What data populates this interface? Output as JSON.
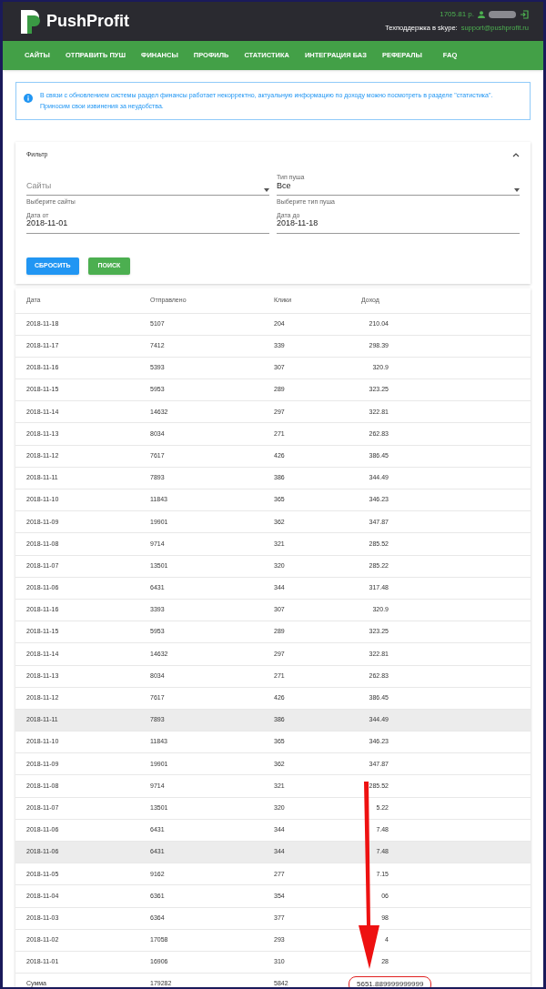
{
  "header": {
    "brand": "PushProfit",
    "balance": "1705.81 р.",
    "support_label": "Техподдержка в skype:",
    "support_contact": "support@pushprofit.ru"
  },
  "nav": [
    "САЙТЫ",
    "ОТПРАВИТЬ ПУШ",
    "ФИНАНСЫ",
    "ПРОФИЛЬ",
    "СТАТИСТИКА",
    "ИНТЕГРАЦИЯ БАЗ",
    "РЕФЕРАЛЫ",
    "FAQ"
  ],
  "alert": "В связи с обновлением системы раздел финансы работает некорректно, актуальную информацию по доходу можно посмотреть в разделе \"статистика\". Приносим свои извинения за неудобства.",
  "filter": {
    "title": "Фильтр",
    "expanded": true,
    "sites": {
      "kind": "select",
      "placeholder": "Сайты",
      "hint": "Выберите сайты"
    },
    "push_type": {
      "kind": "select",
      "label": "Тип пуша",
      "value": "Все",
      "hint": "Выберите тип пуша"
    },
    "date_from": {
      "label": "Дата от",
      "value": "2018-11-01"
    },
    "date_to": {
      "label": "Дата до",
      "value": "2018-11-18"
    },
    "reset_button": "СБРОСИТЬ",
    "search_button": "ПОИСК"
  },
  "table": {
    "columns": [
      "Дата",
      "Отправлено",
      "Клики",
      "Доход"
    ],
    "rows": [
      {
        "cells": [
          "2018-11-18",
          "5107",
          "204",
          "210.04"
        ],
        "highlighted": false
      },
      {
        "cells": [
          "2018-11-17",
          "7412",
          "339",
          "298.39"
        ],
        "highlighted": false
      },
      {
        "cells": [
          "2018-11-16",
          "5393",
          "307",
          "320.9"
        ],
        "highlighted": false
      },
      {
        "cells": [
          "2018-11-15",
          "5953",
          "289",
          "323.25"
        ],
        "highlighted": false
      },
      {
        "cells": [
          "2018-11-14",
          "14632",
          "297",
          "322.81"
        ],
        "highlighted": false
      },
      {
        "cells": [
          "2018-11-13",
          "8034",
          "271",
          "262.83"
        ],
        "highlighted": false
      },
      {
        "cells": [
          "2018-11-12",
          "7617",
          "426",
          "386.45"
        ],
        "highlighted": false
      },
      {
        "cells": [
          "2018-11-11",
          "7893",
          "386",
          "344.49"
        ],
        "highlighted": false
      },
      {
        "cells": [
          "2018-11-10",
          "11843",
          "365",
          "346.23"
        ],
        "highlighted": false
      },
      {
        "cells": [
          "2018-11-09",
          "19901",
          "362",
          "347.87"
        ],
        "highlighted": false
      },
      {
        "cells": [
          "2018-11-08",
          "9714",
          "321",
          "285.52"
        ],
        "highlighted": false
      },
      {
        "cells": [
          "2018-11-07",
          "13501",
          "320",
          "285.22"
        ],
        "highlighted": false
      },
      {
        "cells": [
          "2018-11-06",
          "6431",
          "344",
          "317.48"
        ],
        "highlighted": false
      },
      {
        "cells": [
          "2018-11-16",
          "3393",
          "307",
          "320.9"
        ],
        "highlighted": false
      },
      {
        "cells": [
          "2018-11-15",
          "5953",
          "289",
          "323.25"
        ],
        "highlighted": false
      },
      {
        "cells": [
          "2018-11-14",
          "14632",
          "297",
          "322.81"
        ],
        "highlighted": false
      },
      {
        "cells": [
          "2018-11-13",
          "8034",
          "271",
          "262.83"
        ],
        "highlighted": false
      },
      {
        "cells": [
          "2018-11-12",
          "7617",
          "426",
          "386.45"
        ],
        "highlighted": false
      },
      {
        "cells": [
          "2018-11-11",
          "7893",
          "386",
          "344.49"
        ],
        "highlighted": true
      },
      {
        "cells": [
          "2018-11-10",
          "11843",
          "365",
          "346.23"
        ],
        "highlighted": false
      },
      {
        "cells": [
          "2018-11-09",
          "19901",
          "362",
          "347.87"
        ],
        "highlighted": false
      },
      {
        "cells": [
          "2018-11-08",
          "9714",
          "321",
          "285.52"
        ],
        "highlighted": false
      },
      {
        "cells": [
          "2018-11-07",
          "13501",
          "320",
          "5.22"
        ],
        "highlighted": false
      },
      {
        "cells": [
          "2018-11-06",
          "6431",
          "344",
          "7.48"
        ],
        "highlighted": false
      },
      {
        "cells": [
          "2018-11-06",
          "6431",
          "344",
          "7.48"
        ],
        "highlighted": true
      },
      {
        "cells": [
          "2018-11-05",
          "9162",
          "277",
          "7.15"
        ],
        "highlighted": false
      },
      {
        "cells": [
          "2018-11-04",
          "6361",
          "354",
          "06"
        ],
        "highlighted": false
      },
      {
        "cells": [
          "2018-11-03",
          "6364",
          "377",
          "98"
        ],
        "highlighted": false
      },
      {
        "cells": [
          "2018-11-02",
          "17058",
          "293",
          "4"
        ],
        "highlighted": false
      },
      {
        "cells": [
          "2018-11-01",
          "16906",
          "310",
          "28"
        ],
        "highlighted": false
      }
    ],
    "total": {
      "cells": [
        "Сумма",
        "179282",
        "5842",
        "5651.889999999999"
      ]
    }
  }
}
